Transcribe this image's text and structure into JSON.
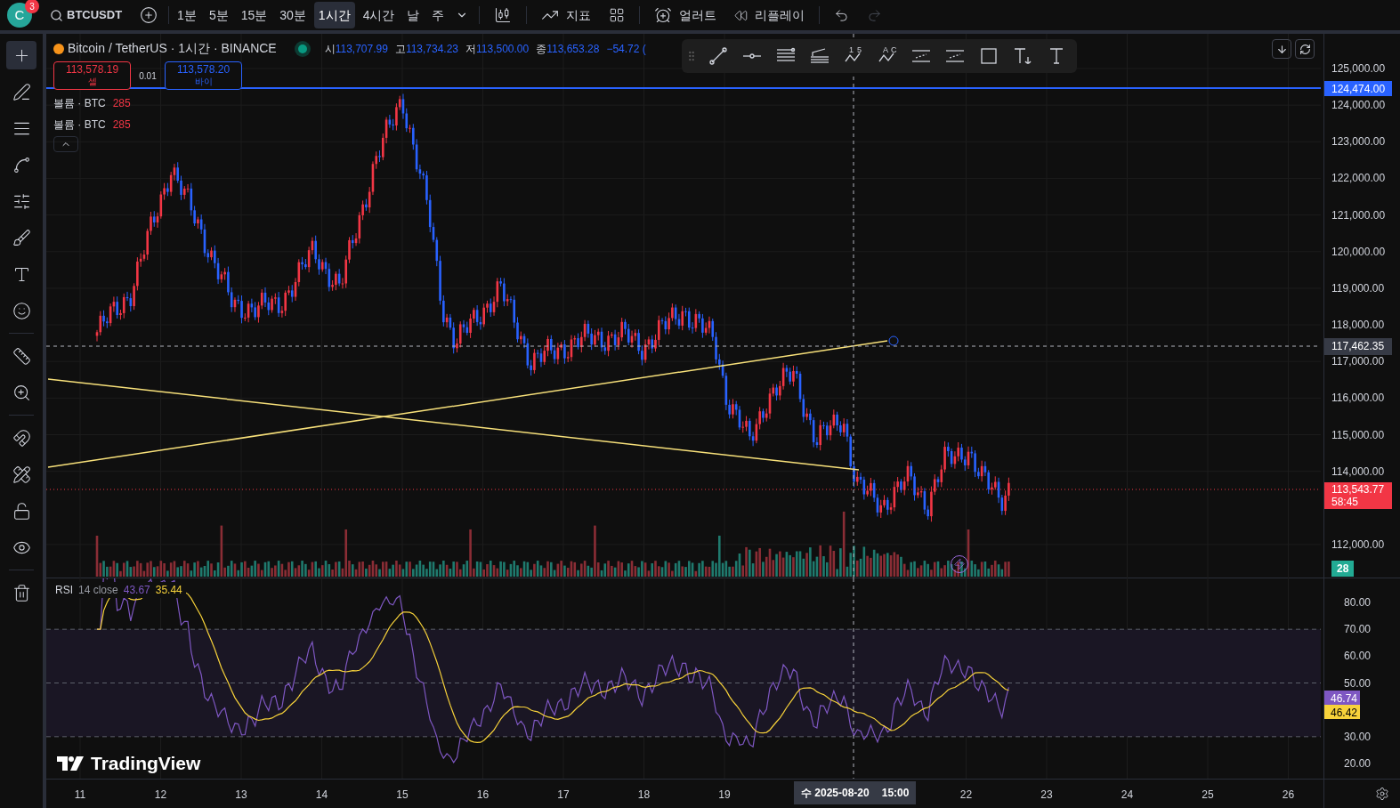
{
  "top_bar": {
    "avatar": "C",
    "notifications": "3",
    "symbol": "BTCUSDT",
    "intervals": [
      {
        "label": "1분",
        "selected": false
      },
      {
        "label": "5분",
        "selected": false
      },
      {
        "label": "15분",
        "selected": false
      },
      {
        "label": "30분",
        "selected": false
      },
      {
        "label": "1시간",
        "selected": true
      },
      {
        "label": "4시간",
        "selected": false
      },
      {
        "label": "날",
        "selected": false
      },
      {
        "label": "주",
        "selected": false
      }
    ],
    "indicators": "지표",
    "alerts": "얼러트",
    "replay": "리플레이",
    "redo_disabled": true
  },
  "legend": {
    "title": "Bitcoin / TetherUS · 1시간 · BINANCE",
    "ohlc": [
      {
        "label": "시",
        "value": "113,707.99"
      },
      {
        "label": "고",
        "value": "113,734.23"
      },
      {
        "label": "저",
        "value": "113,500.00"
      },
      {
        "label": "종",
        "value": "113,653.28"
      }
    ],
    "change": "−54.72 (",
    "sell": {
      "price": "113,578.19",
      "label": "셀"
    },
    "spread": "0.01",
    "buy": {
      "price": "113,578.20",
      "label": "바이"
    },
    "volumes": [
      {
        "label": "볼륨 · BTC",
        "value": "285"
      },
      {
        "label": "볼륨 · BTC",
        "value": "285"
      }
    ]
  },
  "drawing_toolbar": {
    "tools": [
      {
        "kind": "trend"
      },
      {
        "kind": "hray"
      },
      {
        "kind": "lines"
      },
      {
        "kind": "fib"
      },
      {
        "kind": "pattern",
        "marks": "1 5"
      },
      {
        "kind": "pattern",
        "marks": "A C"
      },
      {
        "kind": "channel"
      },
      {
        "kind": "channel"
      },
      {
        "kind": "rect"
      },
      {
        "kind": "anchor"
      },
      {
        "kind": "text"
      }
    ]
  },
  "price_axis": {
    "ticks": [
      "125,000.00",
      "124,000.00",
      "123,000.00",
      "122,000.00",
      "121,000.00",
      "120,000.00",
      "119,000.00",
      "118,000.00",
      "117,000.00",
      "116,000.00",
      "115,000.00",
      "114,000.00",
      "112,000.00"
    ],
    "line_label": "124,474.00",
    "crosshair_label": "117,462.35",
    "last_price": "113,543.77",
    "countdown": "58:45",
    "volume_label": "28"
  },
  "rsi": {
    "name": "RSI",
    "params": "14 close",
    "value": "43.67",
    "ma_value": "35.44",
    "ticks": [
      "80.00",
      "70.00",
      "60.00",
      "50.00",
      "30.00",
      "20.00"
    ],
    "label": "46.74",
    "ma_label": "46.42"
  },
  "watermark": "TradingView",
  "time_axis": {
    "ticks": [
      "11",
      "12",
      "13",
      "14",
      "15",
      "16",
      "17",
      "18",
      "19",
      "22",
      "23",
      "24",
      "25",
      "26"
    ],
    "crosshair_day": "수 2025-08-20",
    "crosshair_time": "15:00"
  }
}
